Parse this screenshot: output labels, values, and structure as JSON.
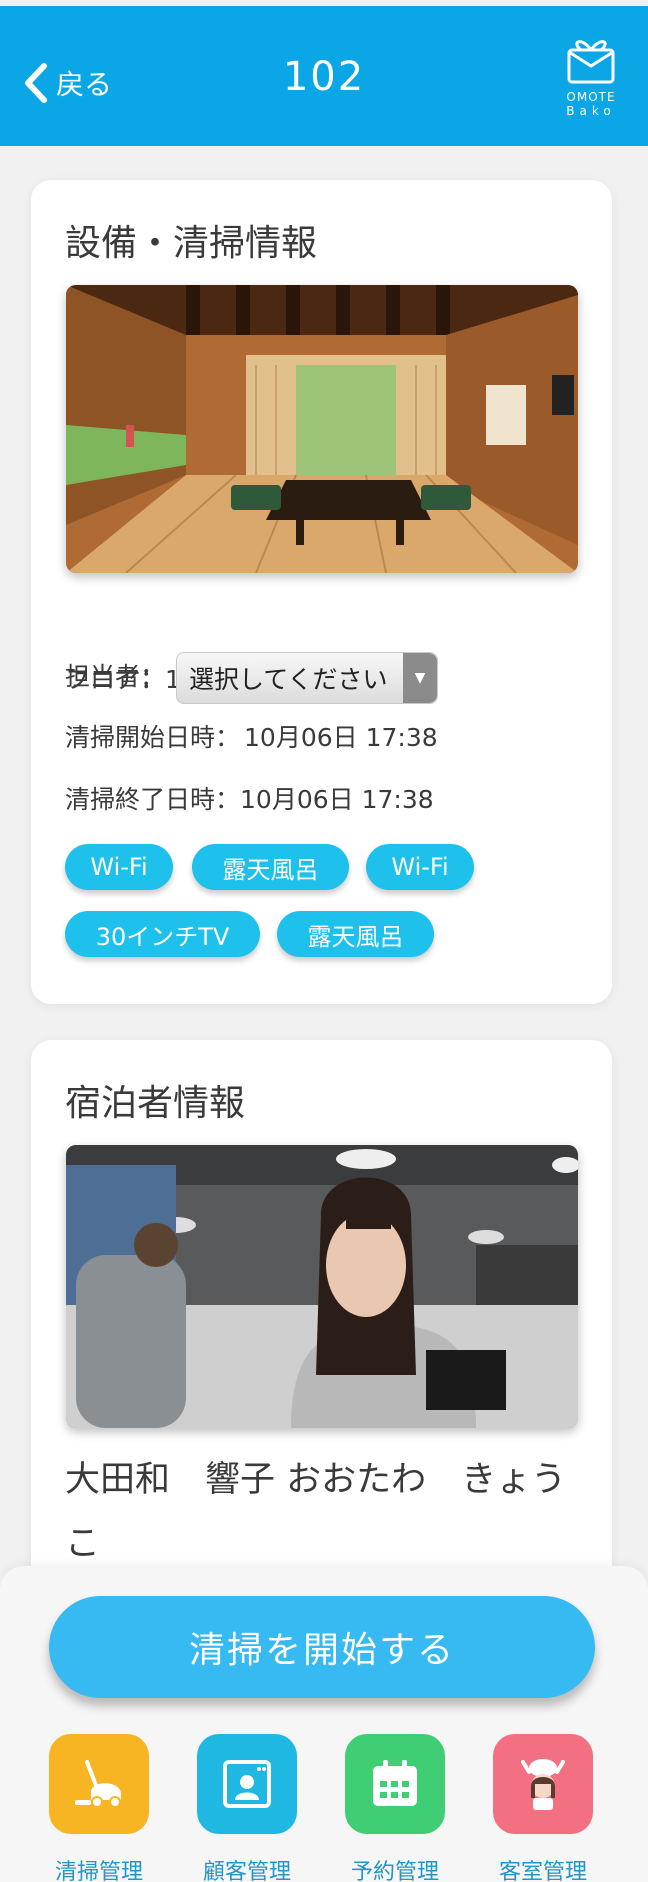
{
  "header": {
    "back_label": "戻る",
    "title": "102",
    "logo_line1": "OMOTE",
    "logo_line2": "Bako"
  },
  "facility": {
    "section_title": "設備・清掃情報",
    "floor_label": "フロア：",
    "floor_value": "1階",
    "staff_label": "担当者：",
    "staff_select_value": "選択してください",
    "start_label": "清掃開始日時：",
    "start_value": "10月06日 17:38",
    "end_label": "清掃終了日時：",
    "end_value": "10月06日 17:38",
    "tags": [
      "Wi-Fi",
      "露天風呂",
      "Wi-Fi",
      "30インチTV",
      "露天風呂"
    ]
  },
  "guest": {
    "section_title": "宿泊者情報",
    "name": "大田和　響子 おおたわ　きょうこ"
  },
  "actions": {
    "start_cleaning": "清掃を開始する"
  },
  "bottom_nav": [
    {
      "label": "清掃管理",
      "icon": "vacuum-cleaner-icon",
      "color": "#f7b524"
    },
    {
      "label": "顧客管理",
      "icon": "customer-card-icon",
      "color": "#1fb8e3"
    },
    {
      "label": "予約管理",
      "icon": "calendar-icon",
      "color": "#3fce74"
    },
    {
      "label": "客室管理",
      "icon": "room-staff-icon",
      "color": "#f36f82"
    }
  ],
  "colors": {
    "header": "#0aa6e6",
    "tag": "#1ec0ec",
    "primary_button": "#37b9f2",
    "nav_label": "#2196c8"
  }
}
